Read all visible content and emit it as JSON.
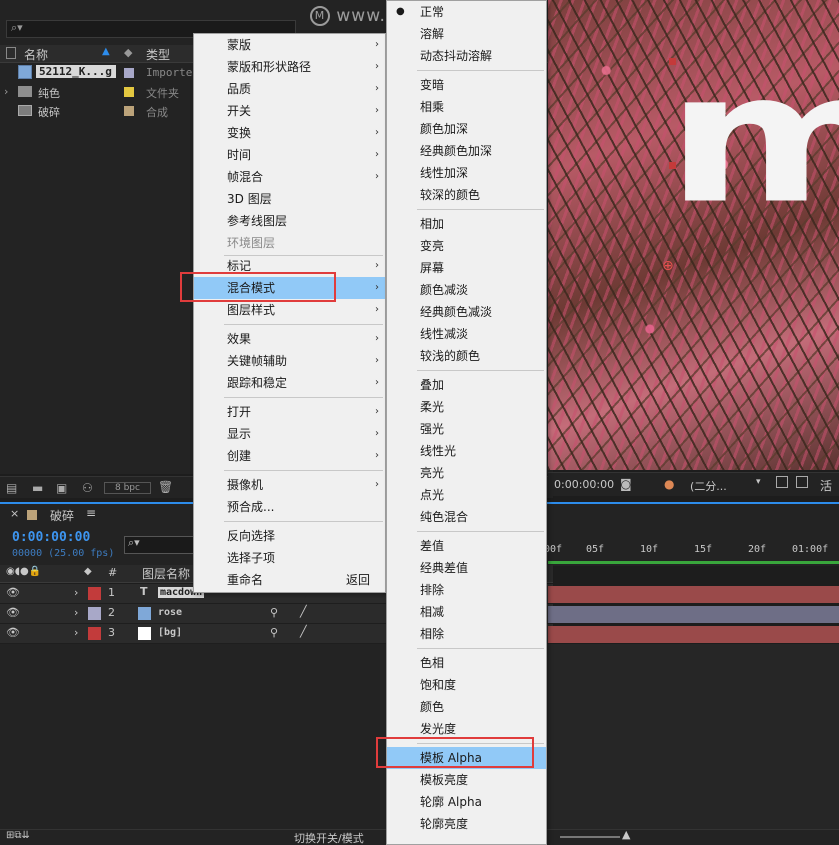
{
  "watermark": {
    "text": "www.MacDown.com"
  },
  "project": {
    "columns": {
      "name": "名称",
      "type": "类型"
    },
    "items": [
      {
        "name": "52112_K...g",
        "type": "Importe...",
        "color": "#a7a7c8"
      },
      {
        "name": "纯色",
        "type": "文件夹",
        "color": "#e3c740"
      },
      {
        "name": "破碎",
        "type": "合成",
        "color": "#bca37a"
      }
    ],
    "bpc": "8 bpc"
  },
  "viewer": {
    "preview_text": "ma",
    "timecode": "0:00:00:00",
    "resolution": "(二分...",
    "active_label": "活"
  },
  "timeline": {
    "comp_name": "破碎",
    "timecode": "0:00:00:00",
    "frame_info": "00000 (25.00 fps)",
    "column_header": "图层名称",
    "hash_col": "#",
    "ruler": [
      "00f",
      "05f",
      "10f",
      "15f",
      "20f",
      "01:00f"
    ],
    "layers": [
      {
        "index": "1",
        "type_glyph": "T",
        "name": "macdown",
        "color": "#c23b3b",
        "bar": "#9a4a4a"
      },
      {
        "index": "2",
        "type_glyph": "",
        "name": "rose",
        "color": "#a8a8c8",
        "bar": "#6e6e86"
      },
      {
        "index": "3",
        "type_glyph": "",
        "name": "[bg]",
        "color": "#c23b3b",
        "bar": "#9a4a4a"
      }
    ],
    "footer_label": "切换开关/模式"
  },
  "menu1": {
    "items": [
      {
        "label": "蒙版",
        "sub": true
      },
      {
        "label": "蒙版和形状路径",
        "sub": true
      },
      {
        "label": "品质",
        "sub": true
      },
      {
        "label": "开关",
        "sub": true
      },
      {
        "label": "变换",
        "sub": true
      },
      {
        "label": "时间",
        "sub": true
      },
      {
        "label": "帧混合",
        "sub": true
      },
      {
        "label": "3D 图层",
        "sub": false
      },
      {
        "label": "参考线图层",
        "sub": false
      },
      {
        "label": "环境图层",
        "sub": false,
        "disabled": true
      },
      {
        "label": "标记",
        "sub": true
      },
      {
        "label": "混合模式",
        "sub": true,
        "hover": true
      },
      {
        "label": "图层样式",
        "sub": true
      },
      {
        "label": "效果",
        "sub": true
      },
      {
        "label": "关键帧辅助",
        "sub": true
      },
      {
        "label": "跟踪和稳定",
        "sub": true
      },
      {
        "label": "打开",
        "sub": true
      },
      {
        "label": "显示",
        "sub": true
      },
      {
        "label": "创建",
        "sub": true
      },
      {
        "label": "摄像机",
        "sub": true
      },
      {
        "label": "预合成...",
        "sub": false
      },
      {
        "label": "反向选择",
        "sub": false
      },
      {
        "label": "选择子项",
        "sub": false
      },
      {
        "label": "重命名",
        "sub": false,
        "accel": "返回"
      }
    ]
  },
  "menu2": {
    "items": [
      {
        "label": "正常",
        "checked": true
      },
      {
        "label": "溶解"
      },
      {
        "label": "动态抖动溶解"
      },
      {
        "label": "变暗"
      },
      {
        "label": "相乘"
      },
      {
        "label": "颜色加深"
      },
      {
        "label": "经典颜色加深"
      },
      {
        "label": "线性加深"
      },
      {
        "label": "较深的颜色"
      },
      {
        "label": "相加"
      },
      {
        "label": "变亮"
      },
      {
        "label": "屏幕"
      },
      {
        "label": "颜色减淡"
      },
      {
        "label": "经典颜色减淡"
      },
      {
        "label": "线性减淡"
      },
      {
        "label": "较浅的颜色"
      },
      {
        "label": "叠加"
      },
      {
        "label": "柔光"
      },
      {
        "label": "强光"
      },
      {
        "label": "线性光"
      },
      {
        "label": "亮光"
      },
      {
        "label": "点光"
      },
      {
        "label": "纯色混合"
      },
      {
        "label": "差值"
      },
      {
        "label": "经典差值"
      },
      {
        "label": "排除"
      },
      {
        "label": "相减"
      },
      {
        "label": "相除"
      },
      {
        "label": "色相"
      },
      {
        "label": "饱和度"
      },
      {
        "label": "颜色"
      },
      {
        "label": "发光度"
      },
      {
        "label": "模板 Alpha",
        "hover": true
      },
      {
        "label": "模板亮度"
      },
      {
        "label": "轮廓 Alpha"
      },
      {
        "label": "轮廓亮度"
      }
    ]
  }
}
